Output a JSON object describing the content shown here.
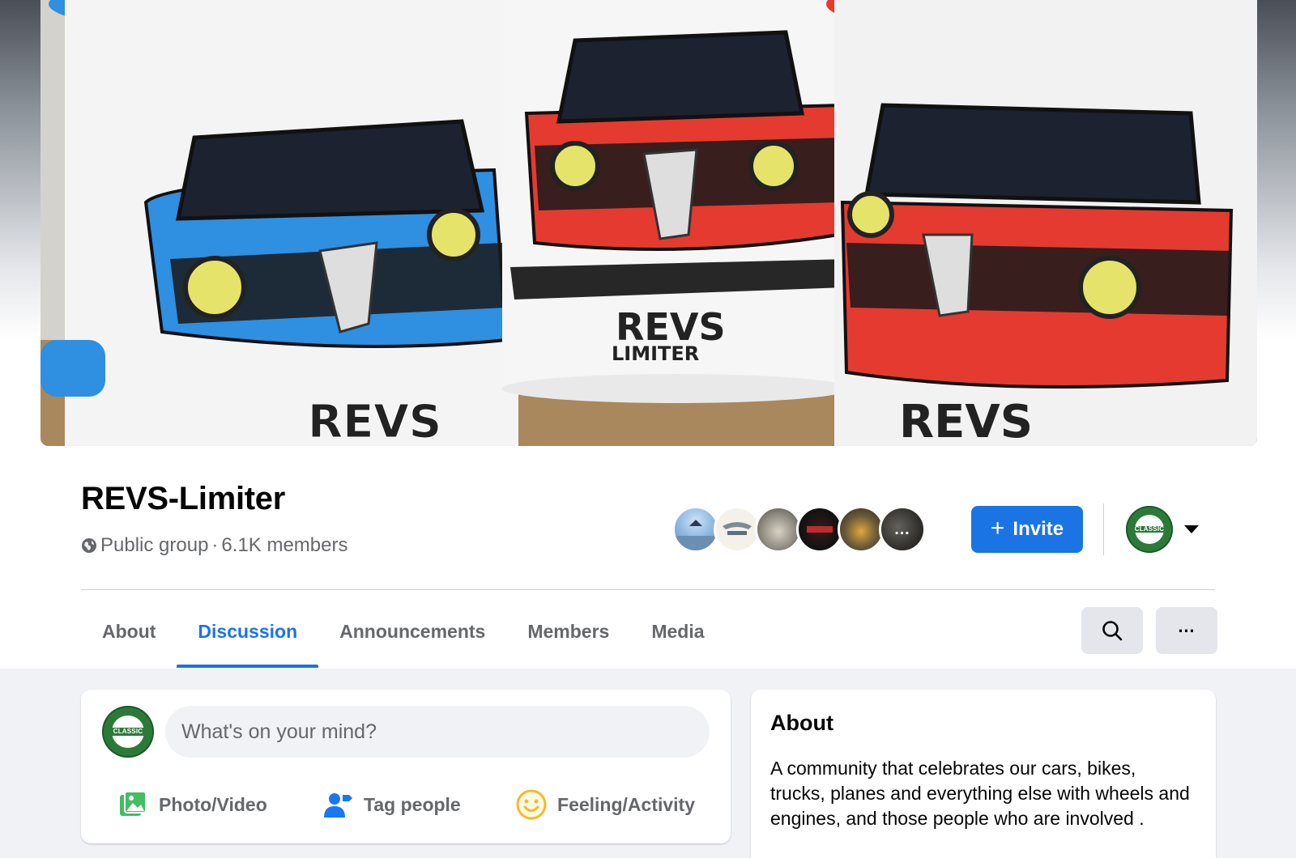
{
  "group": {
    "name": "REVS-Limiter",
    "privacy": "Public group",
    "separator": "·",
    "members": "6.1K members"
  },
  "cover": {
    "mug_text": "REVS LIMITER"
  },
  "actions": {
    "invite_label": "Invite"
  },
  "member_avatars": {
    "overflow": "…"
  },
  "tabs": [
    {
      "label": "About",
      "active": false
    },
    {
      "label": "Discussion",
      "active": true
    },
    {
      "label": "Announcements",
      "active": false
    },
    {
      "label": "Members",
      "active": false
    },
    {
      "label": "Media",
      "active": false
    }
  ],
  "toolbar": {
    "more_label": "…"
  },
  "composer": {
    "placeholder": "What's on your mind?",
    "photo_label": "Photo/Video",
    "tag_label": "Tag people",
    "feeling_label": "Feeling/Activity"
  },
  "logo": {
    "text": "CLASSIC"
  },
  "about": {
    "title": "About",
    "description": "A community that celebrates our cars, bikes, trucks, planes and everything else with wheels and engines, and those people who are involved ."
  },
  "colors": {
    "accent": "#1b74e4",
    "logo_green": "#2c7a3a",
    "mug_blue": "#2f8fe0",
    "mug_red": "#e53a2f"
  },
  "icons": [
    "globe-icon",
    "plus-icon",
    "caret-down-icon",
    "search-icon",
    "more-icon",
    "photo-video-icon",
    "tag-people-icon",
    "feeling-icon"
  ]
}
